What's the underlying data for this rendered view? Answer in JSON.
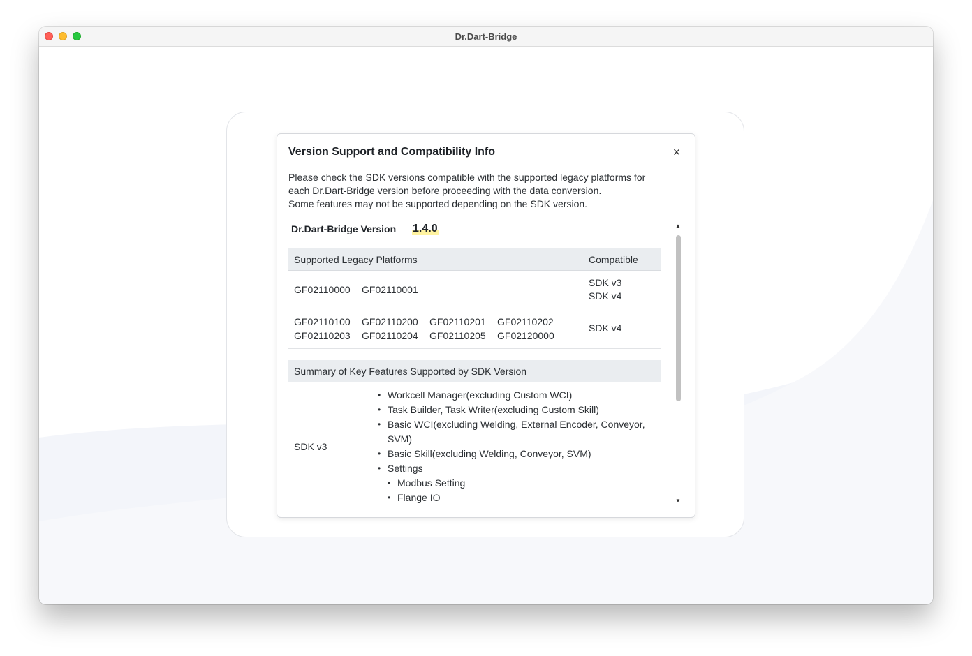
{
  "window": {
    "title": "Dr.Dart-Bridge"
  },
  "modal": {
    "title": "Version Support and Compatibility Info",
    "close_icon": "×",
    "description": [
      "Please check the SDK versions compatible with the supported legacy platforms for",
      "each Dr.Dart-Bridge version before proceeding with the data conversion.",
      "Some features may not be supported depending on the SDK version."
    ],
    "version_label": "Dr.Dart-Bridge Version",
    "version_value": "1.4.0",
    "platforms_table": {
      "headers": [
        "Supported Legacy Platforms",
        "Compatible"
      ],
      "rows": [
        {
          "codes": [
            "GF02110000",
            "GF02110001"
          ],
          "compatible": [
            "SDK v3",
            "SDK v4"
          ]
        },
        {
          "codes": [
            "GF02110100",
            "GF02110200",
            "GF02110201",
            "GF02110202",
            "GF02110203",
            "GF02110204",
            "GF02110205",
            "GF02120000"
          ],
          "compatible": [
            "SDK v4"
          ]
        }
      ]
    },
    "summary_table": {
      "header": "Summary of Key Features Supported by SDK Version",
      "rows": [
        {
          "sdk": "SDK v3",
          "features": [
            "Workcell Manager(excluding Custom WCI)",
            "Task Builder, Task Writer(excluding Custom Skill)",
            "Basic WCI(excluding Welding, External Encoder, Conveyor, SVM)",
            "Basic Skill(excluding Welding, Conveyor, SVM)",
            "Settings"
          ],
          "sub_features": [
            "Modbus Setting",
            "Flange IO"
          ]
        }
      ]
    },
    "scrollbar": {
      "up_icon": "▲",
      "down_icon": "▼"
    }
  }
}
